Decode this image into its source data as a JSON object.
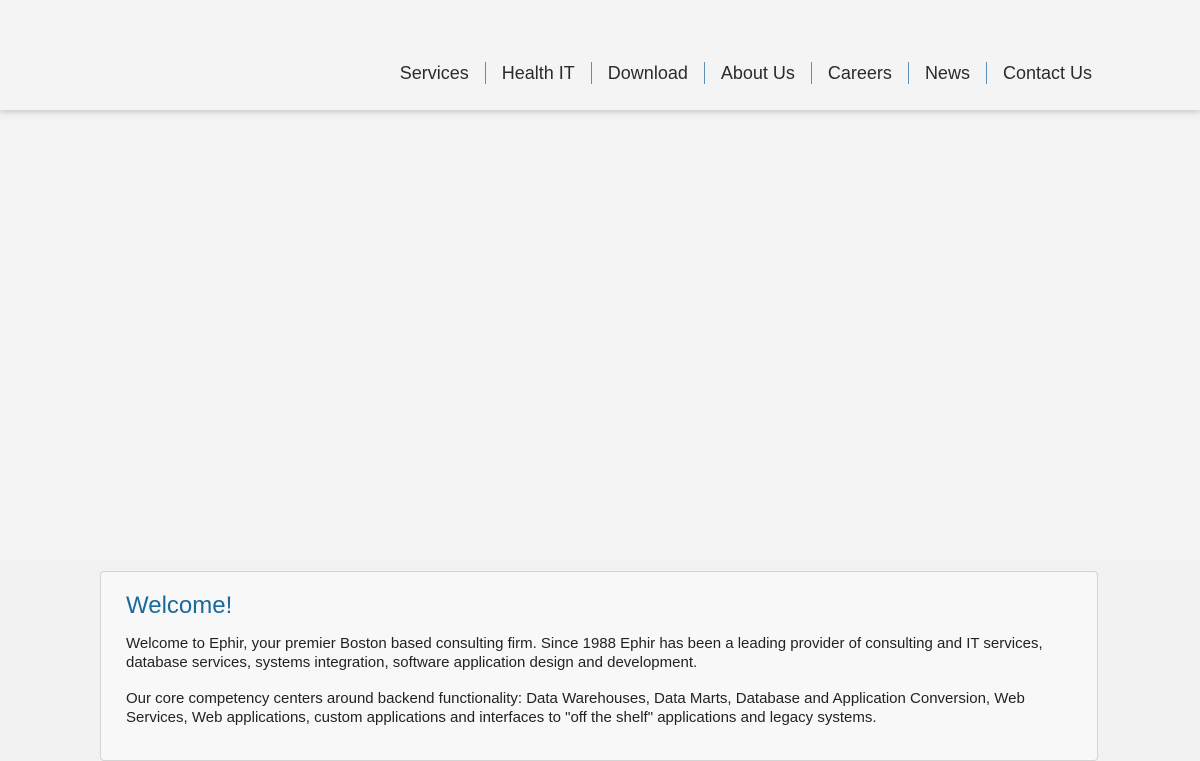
{
  "nav": {
    "items": [
      {
        "label": "Services"
      },
      {
        "label": "Health IT"
      },
      {
        "label": "Download"
      },
      {
        "label": "About Us"
      },
      {
        "label": "Careers"
      },
      {
        "label": "News"
      },
      {
        "label": "Contact Us"
      }
    ]
  },
  "welcome": {
    "title": "Welcome!",
    "paragraphs": [
      "Welcome to Ephir, your premier Boston based consulting firm. Since 1988 Ephir has been a leading provider of consulting and IT services, database services, systems integration, software application design and development.",
      "Our core competency centers around backend functionality: Data Warehouses, Data Marts, Database and Application Conversion, Web Services, Web applications, custom applications and interfaces to \"off the shelf\" applications and legacy systems."
    ]
  },
  "colors": {
    "accent": "#1c6a9a",
    "nav_divider": "#5a8fb8",
    "background": "#f2f2f2"
  }
}
